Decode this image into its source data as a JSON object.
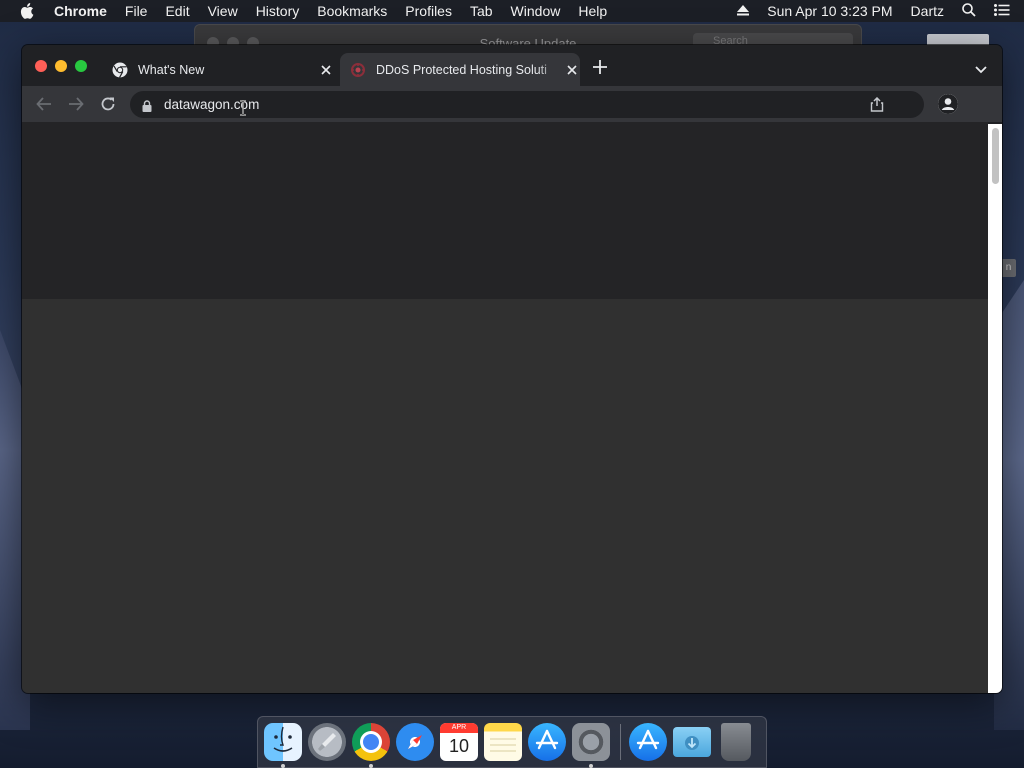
{
  "menubar": {
    "app_name": "Chrome",
    "items": [
      "File",
      "Edit",
      "View",
      "History",
      "Bookmarks",
      "Profiles",
      "Tab",
      "Window",
      "Help"
    ],
    "datetime": "Sun Apr 10  3:23 PM",
    "user": "Dartz"
  },
  "background_window": {
    "title": "Software Update",
    "search_placeholder": "Search"
  },
  "browser": {
    "tabs": [
      {
        "title": "What's New",
        "favicon": "chrome-icon",
        "active": false
      },
      {
        "title": "DDoS Protected Hosting Soluti",
        "favicon": "datawagon-icon",
        "active": true
      }
    ],
    "address": "datawagon.com"
  },
  "side_chip_text": "n",
  "dock": {
    "apps": [
      "Finder",
      "Launchpad",
      "Google Chrome",
      "Safari",
      "Calendar",
      "Notes",
      "App Store",
      "System Preferences",
      "App Store Downloads",
      "Downloads Folder",
      "Trash"
    ],
    "calendar_month": "APR",
    "calendar_day": "10"
  },
  "colors": {
    "tab_active": "#35363a",
    "tabstrip": "#202124",
    "page_hero": "#242426",
    "page_body": "#303030"
  }
}
